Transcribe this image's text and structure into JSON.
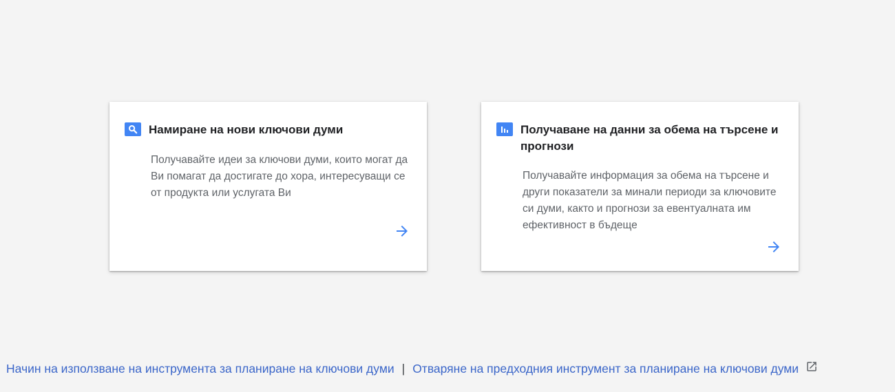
{
  "cards": [
    {
      "icon": "search-icon",
      "title": "Намиране на нови ключови думи",
      "description": "Получавайте идеи за ключови думи, които могат да Ви помагат да достигате до хора, интересуващи се от продукта или услугата Ви"
    },
    {
      "icon": "bar-chart-icon",
      "title": "Получаване на данни за обема на търсене и прогнози",
      "description": "Получавайте информация за обема на търсене и други показатели за минали периоди за ключовите си думи, както и прогнози за евентуалната им ефективност в бъдеще"
    }
  ],
  "footer": {
    "link1": "Начин на използване на инструмента за планиране на ключови думи",
    "separator": "|",
    "link2": "Отваряне на предходния инструмент за планиране на ключови думи",
    "link2_icon": "open-in-new-icon"
  },
  "colors": {
    "accent": "#4285f4",
    "link": "#3b66c9",
    "background": "#f4f4f4"
  }
}
